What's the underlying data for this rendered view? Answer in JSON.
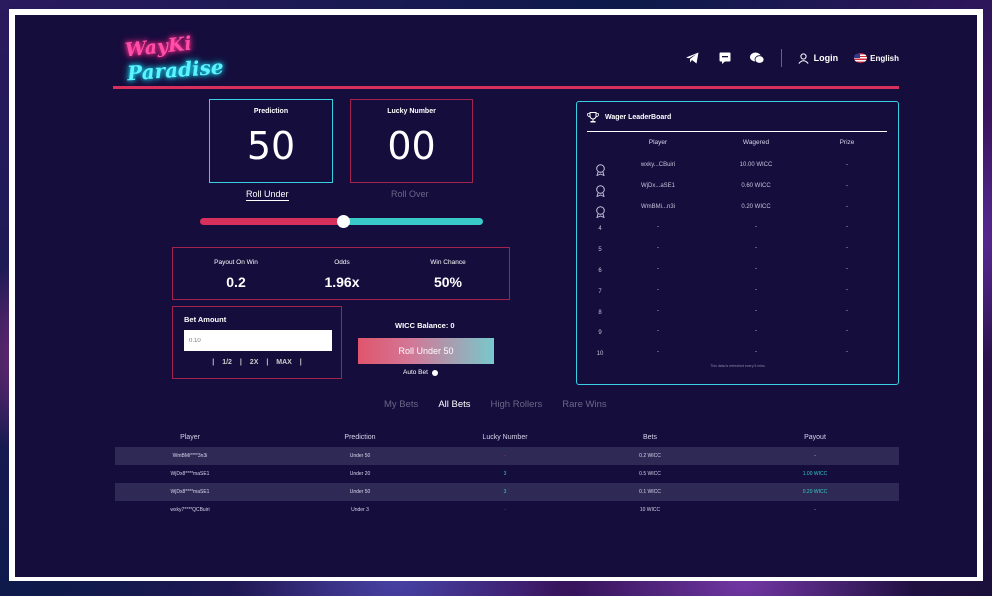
{
  "header": {
    "logo_line1": "WayKi",
    "logo_line2": "Paradise",
    "login_label": "Login",
    "language_label": "English"
  },
  "game": {
    "prediction_label": "Prediction",
    "prediction_value": "50",
    "lucky_label": "Lucky Number",
    "lucky_value": "00",
    "roll_under_label": "Roll Under",
    "roll_over_label": "Roll Over",
    "slider_value_percent": 50,
    "payout_label": "Payout On Win",
    "payout_value": "0.2",
    "odds_label": "Odds",
    "odds_value": "1.96x",
    "win_chance_label": "Win Chance",
    "win_chance_value": "50%",
    "bet_amount_label": "Bet Amount",
    "bet_amount_placeholder": "0.10",
    "half_label": "1/2",
    "double_label": "2X",
    "max_label": "MAX",
    "balance_text": "WICC Balance: 0",
    "roll_button_label": "Roll Under 50",
    "auto_bet_label": "Auto Bet"
  },
  "leaderboard": {
    "title": "Wager LeaderBoard",
    "col_player": "Player",
    "col_wagered": "Wagered",
    "col_prize": "Prize",
    "rows": [
      {
        "rank": "1",
        "player": "wxky...CBuiri",
        "wagered": "10.00 WICC",
        "prize": "-"
      },
      {
        "rank": "2",
        "player": "WjDx...aSE1",
        "wagered": "0.60 WICC",
        "prize": "-"
      },
      {
        "rank": "3",
        "player": "WmBMi...n3i",
        "wagered": "0.20 WICC",
        "prize": "-"
      },
      {
        "rank": "4",
        "player": "-",
        "wagered": "-",
        "prize": "-"
      },
      {
        "rank": "5",
        "player": "-",
        "wagered": "-",
        "prize": "-"
      },
      {
        "rank": "6",
        "player": "-",
        "wagered": "-",
        "prize": "-"
      },
      {
        "rank": "7",
        "player": "-",
        "wagered": "-",
        "prize": "-"
      },
      {
        "rank": "8",
        "player": "-",
        "wagered": "-",
        "prize": "-"
      },
      {
        "rank": "9",
        "player": "-",
        "wagered": "-",
        "prize": "-"
      },
      {
        "rank": "10",
        "player": "-",
        "wagered": "-",
        "prize": "-"
      }
    ],
    "footnote": "This data is refreshed every 5 mins"
  },
  "tabs": [
    "My Bets",
    "All Bets",
    "High Rollers",
    "Rare Wins"
  ],
  "active_tab": "All Bets",
  "bets": {
    "columns": [
      "Player",
      "Prediction",
      "Lucky Number",
      "Bets",
      "Payout"
    ],
    "rows": [
      {
        "player": "WmBMi****3n3i",
        "prediction": "Under 50",
        "lucky": "-",
        "bet": "0.2 WICC",
        "payout": "-"
      },
      {
        "player": "WjDx8****maSE1",
        "prediction": "Under 20",
        "lucky": "3",
        "bet": "0.5 WICC",
        "payout": "1.00 WICC"
      },
      {
        "player": "WjDx8****maSE1",
        "prediction": "Under 50",
        "lucky": "3",
        "bet": "0.1 WICC",
        "payout": "0.20 WICC"
      },
      {
        "player": "wxky7****QCBuiri",
        "prediction": "Under 3",
        "lucky": "-",
        "bet": "10 WICC",
        "payout": "-"
      }
    ]
  },
  "colors": {
    "accent_cyan": "#3ad0e4",
    "accent_red": "#d8305c",
    "panel_bg": "#150d3c",
    "win_green": "#3ac9c9"
  }
}
